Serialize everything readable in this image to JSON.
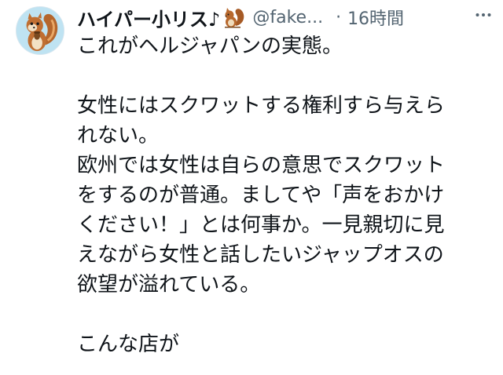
{
  "tweet": {
    "display_name": "ハイパー小リス♪",
    "handle": "@fake...",
    "separator": "·",
    "time": "16時間",
    "name_emoji_icon": "squirrel-icon",
    "more_icon": "more-options-icon",
    "body_lines": [
      "これがヘルジャパンの実態。",
      "",
      "女性にはスクワットする権利すら与えら",
      "れない。",
      "欧州では女性は自らの意思でスクワット",
      "をするのが普通。ましてや「声をおかけ",
      "ください！」とは何事か。一見親切に見",
      "えながら女性と話したいジャップオスの",
      "欲望が溢れている。",
      "",
      "こんな店が"
    ]
  },
  "colors": {
    "text_primary": "#0f1419",
    "text_secondary": "#536471",
    "avatar_background": "#bfe3f2"
  }
}
